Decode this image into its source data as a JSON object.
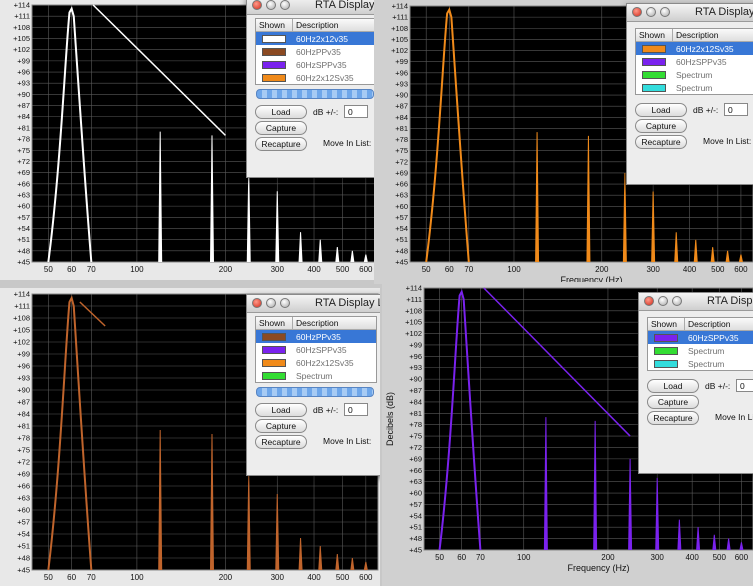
{
  "common": {
    "x_ticks": [
      "50",
      "60",
      "70",
      "100",
      "200",
      "300",
      "400",
      "500",
      "600"
    ],
    "x_tick_values": [
      50,
      60,
      70,
      100,
      200,
      300,
      400,
      500,
      600
    ],
    "x_range": [
      44,
      660
    ],
    "y_ticks": [
      "+114",
      "+111",
      "+108",
      "+105",
      "+102",
      "+99",
      "+96",
      "+93",
      "+90",
      "+87",
      "+84",
      "+81",
      "+78",
      "+75",
      "+72",
      "+69",
      "+66",
      "+63",
      "+60",
      "+57",
      "+54",
      "+51",
      "+48",
      "+45"
    ],
    "y_range": [
      45,
      114
    ],
    "x_axis_label": "Frequency (Hz)",
    "y_axis_label": "Decibels (dB)",
    "legend_title": "RTA Display Legend",
    "col_shown": "Shown",
    "col_description": "Description",
    "load": "Load",
    "capture": "Capture",
    "recapture": "Recapture",
    "db_label": "dB +/-:",
    "db_value": "0",
    "move_label": "Move In List:"
  },
  "quadrants": [
    {
      "trace_color": "#ffffff",
      "legend_rows": [
        {
          "label": "60Hz2x12v35",
          "color": "#ffffff",
          "selected": true
        },
        {
          "label": "60HzPPv35",
          "color": "#8b4a22",
          "selected": false
        },
        {
          "label": "60HzSPPv35",
          "color": "#7a22ee",
          "selected": false
        },
        {
          "label": "60Hz2x12Sv35",
          "color": "#f08a1a",
          "selected": false
        }
      ],
      "slope_line": {
        "from": [
          71,
          114
        ],
        "to": [
          200,
          79
        ]
      }
    },
    {
      "trace_color": "#f08a1a",
      "legend_rows": [
        {
          "label": "60Hz2x12Sv35",
          "color": "#f08a1a",
          "selected": true
        },
        {
          "label": "60HzSPPv35",
          "color": "#7a22ee",
          "selected": false
        },
        {
          "label": "Spectrum",
          "color": "#33dd33",
          "selected": false
        },
        {
          "label": "Spectrum",
          "color": "#33dddd",
          "selected": false
        }
      ],
      "slope_line": null
    },
    {
      "trace_color": "#c0642c",
      "legend_rows": [
        {
          "label": "60HzPPv35",
          "color": "#8b4a22",
          "selected": true
        },
        {
          "label": "60HzSPPv35",
          "color": "#7a22ee",
          "selected": false
        },
        {
          "label": "60Hz2x12Sv35",
          "color": "#f08a1a",
          "selected": false
        },
        {
          "label": "Spectrum",
          "color": "#33dd33",
          "selected": false
        }
      ],
      "slope_line": {
        "from": [
          64,
          112
        ],
        "to": [
          78,
          106
        ]
      }
    },
    {
      "trace_color": "#7a22ee",
      "legend_rows": [
        {
          "label": "60HzSPPv35",
          "color": "#7a22ee",
          "selected": true
        },
        {
          "label": "Spectrum",
          "color": "#33dd33",
          "selected": false
        },
        {
          "label": "Spectrum",
          "color": "#33dddd",
          "selected": false
        }
      ],
      "slope_line": {
        "from": [
          72,
          114
        ],
        "to": [
          240,
          75
        ]
      }
    }
  ]
}
